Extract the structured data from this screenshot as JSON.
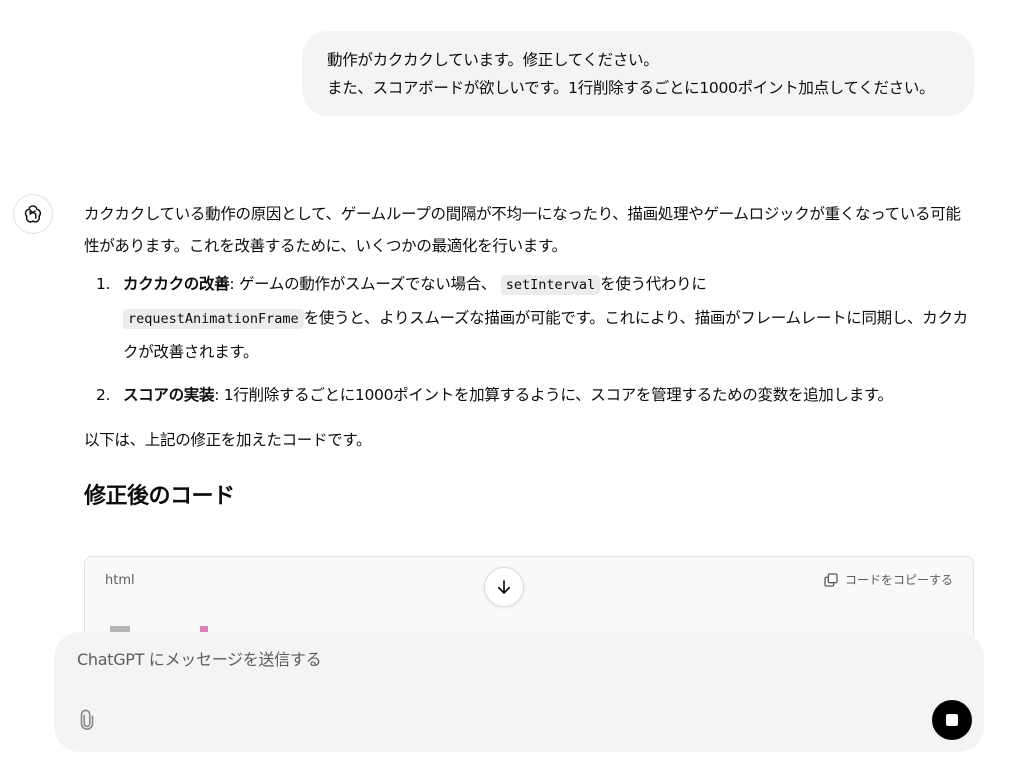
{
  "user_message": {
    "line1": "動作がカクカクしています。修正してください。",
    "line2": "また、スコアボードが欲しいです。1行削除するごとに1000ポイント加点してください。"
  },
  "assistant": {
    "intro": "カクカクしている動作の原因として、ゲームループの間隔が不均一になったり、描画処理やゲームロジックが重くなっている可能性があります。これを改善するために、いくつかの最適化を行います。",
    "points": [
      {
        "num": "1.",
        "title": "カクカクの改善",
        "text_a": ": ゲームの動作がスムーズでない場合、",
        "code_a": "setInterval",
        "text_b": "を使う代わりに",
        "code_b": "requestAnimationFrame",
        "text_c": "を使うと、よりスムーズな描画が可能です。これにより、描画がフレームレートに同期し、カクカクが改善されます。"
      },
      {
        "num": "2.",
        "title": "スコアの実装",
        "text_a": ": 1行削除するごとに1000ポイントを加算するように、スコアを管理するための変数を追加します。"
      }
    ],
    "after": "以下は、上記の修正を加えたコードです。",
    "section_title": "修正後のコード"
  },
  "code_block": {
    "lang": "html",
    "copy_label": "コードをコピーする"
  },
  "composer": {
    "placeholder": "ChatGPT にメッセージを送信する"
  },
  "icons": {
    "avatar": "chatgpt-logo-icon",
    "scroll": "arrow-down-icon",
    "copy": "copy-icon",
    "attach": "paperclip-icon",
    "stop": "stop-icon"
  }
}
